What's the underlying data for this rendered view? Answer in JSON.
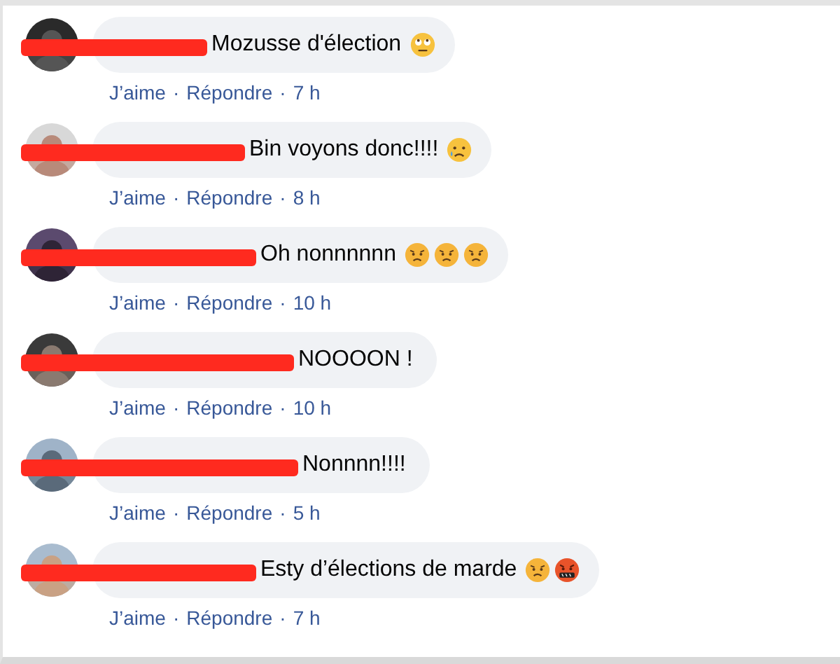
{
  "comments": [
    {
      "redacted": true,
      "text": "Mozusse d'élection",
      "emojis": [
        {
          "kind": "rolling-eyes"
        }
      ],
      "actions": [
        "J’aime",
        "Répondre"
      ],
      "separator": "·",
      "time": "7 h"
    },
    {
      "redacted": true,
      "text": "Bin voyons donc!!!!",
      "emojis": [
        {
          "kind": "crying"
        }
      ],
      "actions": [
        "J’aime",
        "Répondre"
      ],
      "separator": "·",
      "time": "8 h"
    },
    {
      "redacted": true,
      "text": "Oh nonnnnnn",
      "emojis": [
        {
          "kind": "frowning"
        },
        {
          "kind": "frowning"
        },
        {
          "kind": "frowning"
        }
      ],
      "actions": [
        "J’aime",
        "Répondre"
      ],
      "separator": "·",
      "time": "10 h"
    },
    {
      "redacted": true,
      "text": "NOOOON !",
      "actions": [
        "J’aime",
        "Répondre"
      ],
      "separator": "·",
      "time": "10 h"
    },
    {
      "redacted": true,
      "text": "Nonnnn!!!!",
      "actions": [
        "J’aime",
        "Répondre"
      ],
      "separator": "·",
      "time": "5 h"
    },
    {
      "redacted": true,
      "text": "Esty d’élections de marde",
      "emojis": [
        {
          "kind": "frowning"
        },
        {
          "kind": "cursing"
        }
      ],
      "actions": [
        "J’aime",
        "Répondre"
      ],
      "separator": "·",
      "time": "7 h"
    }
  ]
}
